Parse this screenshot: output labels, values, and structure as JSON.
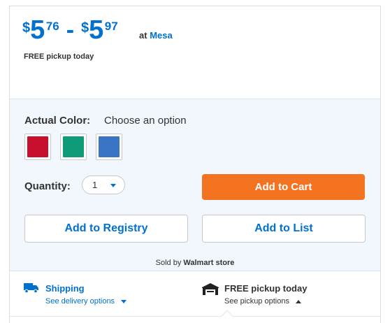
{
  "price": {
    "currency": "$",
    "low_dollars": "5",
    "low_cents": "76",
    "separator": "-",
    "high_dollars": "5",
    "high_cents": "97",
    "at_text": "at",
    "store_name": "Mesa"
  },
  "free_pickup_text": "FREE pickup today",
  "color": {
    "label": "Actual Color:",
    "value": "Choose an option",
    "swatches": [
      {
        "name": "red",
        "hex": "#c8102e"
      },
      {
        "name": "green",
        "hex": "#0f9a78"
      },
      {
        "name": "blue",
        "hex": "#3a74c4"
      }
    ]
  },
  "quantity": {
    "label": "Quantity:",
    "value": "1"
  },
  "buttons": {
    "add_to_cart": "Add to Cart",
    "add_to_registry": "Add to Registry",
    "add_to_list": "Add to List"
  },
  "sold_by": {
    "prefix": "Sold by",
    "seller": "Walmart store"
  },
  "delivery": {
    "shipping_title": "Shipping",
    "shipping_link": "See delivery options",
    "shipping_icon": "truck-icon",
    "pickup_title": "FREE pickup today",
    "pickup_link": "See pickup options",
    "pickup_icon": "store-icon"
  },
  "colors": {
    "brand_blue": "#0071ce",
    "cta_orange": "#f47321",
    "options_bg": "#f2f7fd"
  }
}
